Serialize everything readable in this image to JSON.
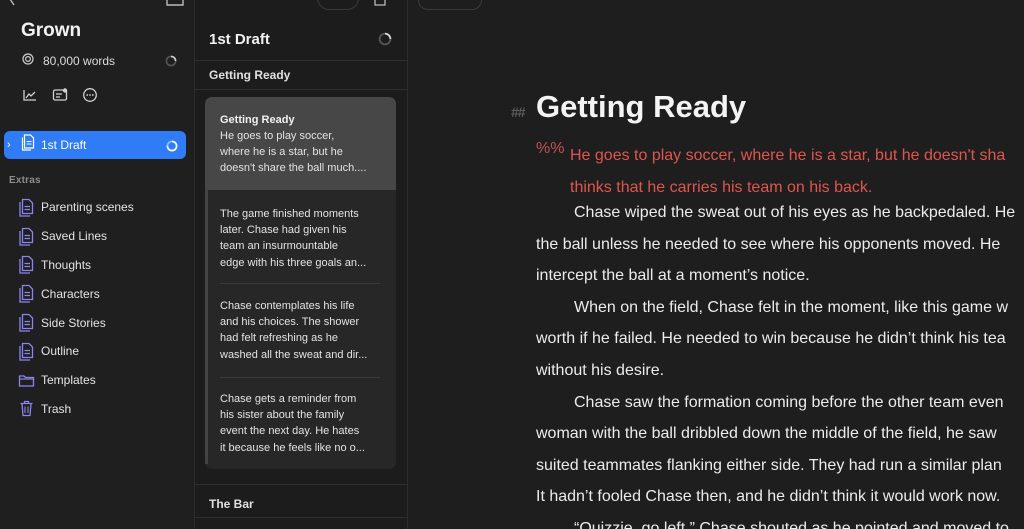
{
  "sidebar": {
    "project_title": "Grown",
    "word_count": "80,000 words",
    "draft": {
      "label": "1st Draft",
      "expanded": false
    },
    "extras_label": "Extras",
    "items": [
      {
        "label": "Parenting scenes",
        "icon": "document-stack-icon"
      },
      {
        "label": "Saved Lines",
        "icon": "document-stack-icon"
      },
      {
        "label": "Thoughts",
        "icon": "document-stack-icon"
      },
      {
        "label": "Characters",
        "icon": "document-stack-icon"
      },
      {
        "label": "Side Stories",
        "icon": "document-stack-icon"
      },
      {
        "label": "Outline",
        "icon": "document-stack-icon"
      },
      {
        "label": "Templates",
        "icon": "folder-icon"
      },
      {
        "label": "Trash",
        "icon": "trash-icon"
      }
    ]
  },
  "scenes": {
    "draft_title": "1st Draft",
    "chapter1": "Getting Ready",
    "cards": [
      {
        "title": "Getting Ready",
        "lines": [
          "He goes to play soccer,",
          "where he is a star, but he",
          "doesn't share the ball much...."
        ]
      },
      {
        "title": "",
        "lines": [
          "The game finished moments",
          "later. Chase had given his",
          "team an insurmountable",
          "edge with his three goals an..."
        ]
      },
      {
        "title": "",
        "lines": [
          "Chase contemplates his life",
          "and his choices. The shower",
          "had felt refreshing as he",
          "washed all the sweat and dir..."
        ]
      },
      {
        "title": "",
        "lines": [
          "Chase gets a reminder from",
          "his sister about the family",
          "event the next day. He hates",
          "it because he feels like no o..."
        ]
      }
    ],
    "chapter2": "The Bar"
  },
  "editor": {
    "heading_marker": "##",
    "heading": "Getting Ready",
    "comment_marker": "%%",
    "comment_lines": [
      "He goes to play soccer, where he is a star, but he doesn't sha",
      "thinks that he carries his team on his back."
    ],
    "body_lines": [
      {
        "text": "Chase wiped the sweat out of his eyes as he backpedaled. He",
        "indent": true
      },
      {
        "text": "the ball unless he needed to see where his opponents moved. He",
        "indent": false
      },
      {
        "text": "intercept the ball at a moment’s notice.",
        "indent": false
      },
      {
        "text": "When on the field, Chase felt in the moment, like this game w",
        "indent": true
      },
      {
        "text": "worth if he failed. He needed to win because he didn’t think his tea",
        "indent": false
      },
      {
        "text": "without his desire.",
        "indent": false
      },
      {
        "text": "Chase saw the formation coming before the other team even",
        "indent": true
      },
      {
        "text": "woman with the ball dribbled down the middle of the field, he saw",
        "indent": false
      },
      {
        "text": "suited teammates flanking either side. They had run a similar plan",
        "indent": false
      },
      {
        "text": "It hadn’t fooled Chase then, and he didn’t think it would work now.",
        "indent": false
      },
      {
        "text": "“Quizzie, go left,” Chase shouted as he pointed and moved to",
        "indent": true
      }
    ]
  },
  "colors": {
    "accent": "#2f7cf6",
    "icon_purple": "#8b84f0",
    "comment_red": "#e0554f",
    "selected_card": "#474747"
  }
}
